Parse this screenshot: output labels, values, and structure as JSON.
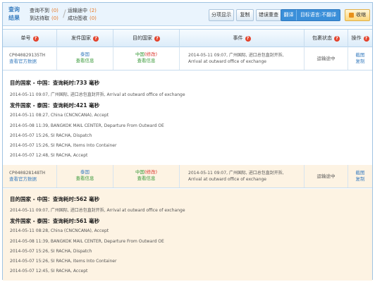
{
  "header": {
    "title": "查询结果",
    "stats": [
      {
        "label": "查询不到",
        "count": "(0)"
      },
      {
        "label": "到达待取",
        "count": "(0)"
      },
      {
        "label": "运输途中",
        "count": "(2)"
      },
      {
        "label": "成功签收",
        "count": "(0)"
      }
    ],
    "buttons": {
      "show": "分项显示",
      "copy": "复制",
      "error": "错误重查",
      "translate": "翻译",
      "target_lang": "目标语言:不翻译",
      "collapse": "收缩"
    }
  },
  "columns": [
    "单号",
    "发件国家",
    "目的国家",
    "事件",
    "包裹状态",
    "操作"
  ],
  "rows": [
    {
      "number": "CP040829135TH",
      "official": "查看官方数据",
      "origin": "泰国",
      "origin_link": "查看信息",
      "dest": "中国",
      "dest_mod": "(修改)",
      "dest_link": "查看信息",
      "event_cn": "2014-05-11 09:07, 广州国际, 进口总包直封开拆,",
      "event_en": "Arrival at outward office of exchange",
      "status": "运输途中",
      "op1": "截图",
      "op2": "复制",
      "dest_section": "目的国家 - 中国：查询耗时:733 毫秒",
      "dest_events": [
        "2014-05-11 09:07, 广州国际, 进口总包直封开拆, Arrival at outward office of exchange"
      ],
      "origin_section": "发件国家 - 泰国：查询耗时:421 毫秒",
      "origin_events": [
        "2014-05-11 08:27, China (CNCNCANA), Accept",
        "2014-05-08 11:39, BANGKOK MAIL CENTER, Departure From Outward OE",
        "2014-05-07 15:26, SI RACHA, Dispatch",
        "2014-05-07 15:26, SI RACHA, Items Into Container",
        "2014-05-07 12:48, SI RACHA, Accept"
      ]
    },
    {
      "number": "CP040828148TH",
      "official": "查看官方数据",
      "origin": "泰国",
      "origin_link": "查看信息",
      "dest": "中国",
      "dest_mod": "(修改)",
      "dest_link": "查看信息",
      "event_cn": "2014-05-11 09:07, 广州国际, 进口总包直封开拆,",
      "event_en": "Arrival at outward office of exchange",
      "status": "运输途中",
      "op1": "截图",
      "op2": "复制",
      "dest_section": "目的国家 - 中国：查询耗时:562 毫秒",
      "dest_events": [
        "2014-05-11 09:07, 广州国际, 进口总包直封开拆, Arrival at outward office of exchange"
      ],
      "origin_section": "发件国家 - 泰国：查询耗时:561 毫秒",
      "origin_events": [
        "2014-05-11 08:28, China (CNCNCANA), Accept",
        "2014-05-08 11:39, BANGKOK MAIL CENTER, Departure From Outward OE",
        "2014-05-07 15:26, SI RACHA, Dispatch",
        "2014-05-07 15:26, SI RACHA, Items Into Container",
        "2014-05-07 12:45, SI RACHA, Accept"
      ]
    }
  ]
}
